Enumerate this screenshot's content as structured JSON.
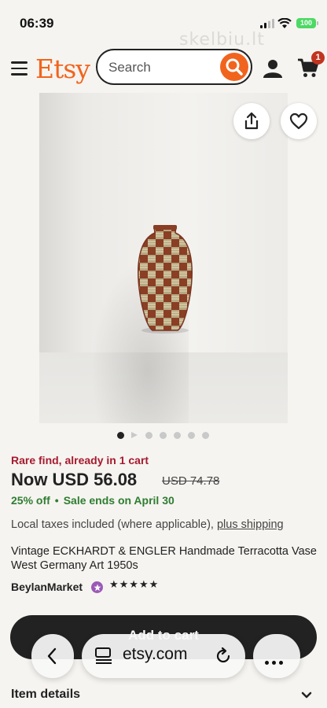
{
  "status_bar": {
    "time": "06:39",
    "battery": "100",
    "watermark": "skelbiu.lt"
  },
  "header": {
    "logo": "Etsy",
    "search_placeholder": "Search",
    "cart_count": "1",
    "accent_color": "#f1641e"
  },
  "gallery": {
    "image_count": 7,
    "active_index": 0
  },
  "product": {
    "scarcity": "Rare find, already in 1 cart",
    "price": "Now USD 56.08",
    "original_price": "USD 74.78",
    "discount": "25% off",
    "bullet": "•",
    "sale_end": "Sale ends on April 30",
    "tax_note": "Local taxes included (where applicable), ",
    "shipping_link": "plus shipping",
    "title": "Vintage ECKHARDT & ENGLER Handmade Terracotta Vase West Germany Art 1950s",
    "shop_name": "BeylanMarket",
    "rating_stars": "★★★★★"
  },
  "actions": {
    "add_to_cart": "Add to cart"
  },
  "browser": {
    "url": "etsy.com"
  },
  "sections": {
    "item_details": "Item details"
  }
}
